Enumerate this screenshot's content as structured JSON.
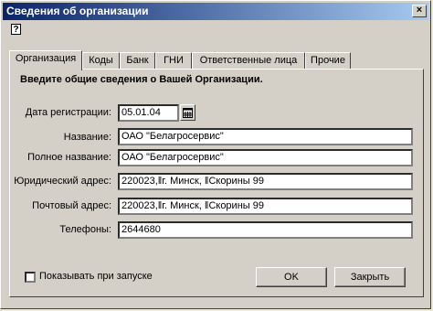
{
  "window": {
    "title": "Сведения об организации",
    "close_glyph": "×"
  },
  "toolbar": {
    "help_glyph": "?"
  },
  "tabs": [
    {
      "label": "Организация",
      "active": true
    },
    {
      "label": "Коды"
    },
    {
      "label": "Банк"
    },
    {
      "label": "ГНИ"
    },
    {
      "label": "Ответственные лица"
    },
    {
      "label": "Прочие"
    }
  ],
  "form": {
    "heading": "Введите общие сведения о Вашей Организации.",
    "reg_date": {
      "label": "Дата регистрации:",
      "value": "05.01.04"
    },
    "name": {
      "label": "Название:",
      "value": "ОАО \"Белагросервис\""
    },
    "full_name": {
      "label": "Полное название:",
      "value": "ОАО \"Белагросервис\""
    },
    "legal_address": {
      "label": "Юридический адрес:",
      "value": "220023,‖г. Минск, ‖Скорины 99"
    },
    "postal_address": {
      "label": "Почтовый адрес:",
      "value": "220023,‖г. Минск, ‖Скорины 99"
    },
    "phones": {
      "label": "Телефоны:",
      "value": "2644680"
    }
  },
  "footer": {
    "show_on_start": {
      "label": "Показывать при запуске",
      "checked": false
    },
    "ok_label": "OK",
    "close_label": "Закрыть"
  }
}
